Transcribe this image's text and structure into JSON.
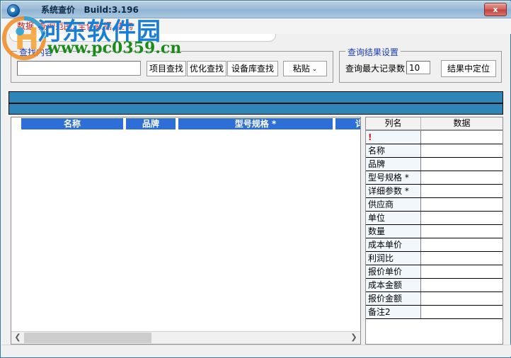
{
  "window": {
    "title": "系统查价   Build:3.196",
    "icon": "app-globe-icon",
    "close_label": "x",
    "accent_blue": "#2e86b8",
    "header_blue": "#2d6fd6",
    "menu_red": "#d81818",
    "legend_blue": "#1a3bb5"
  },
  "menubar": {
    "items": [
      {
        "label": "数据"
      },
      {
        "label": "查询范围: 全体数据"
      },
      {
        "label": "查询"
      }
    ]
  },
  "watermark": {
    "text_cn": "河东软件园",
    "text_url": "www.pc0359.cn",
    "color_cn": "#1a7fd4",
    "color_url": "#1b8a1b"
  },
  "find_group": {
    "legend": "查找内容",
    "input_value": "",
    "input_placeholder": "",
    "buttons": [
      {
        "label": "项目查找"
      },
      {
        "label": "优化查找"
      },
      {
        "label": "设备库查找"
      },
      {
        "label": "粘贴",
        "caret": "⌄"
      }
    ]
  },
  "result_group": {
    "legend": "查询结果设置",
    "max_records_label": "查询最大记录数",
    "max_records_value": "10",
    "locate_button": "结果中定位"
  },
  "grid": {
    "columns": [
      {
        "label": "名称"
      },
      {
        "label": "品牌"
      },
      {
        "label": "型号规格 *"
      },
      {
        "label": "详"
      }
    ],
    "rows": [],
    "scrollbar": {
      "left_arrow": "❮",
      "right_arrow": "❯"
    }
  },
  "detail_panel": {
    "headers": {
      "name": "列名",
      "value": "数据"
    },
    "rows": [
      {
        "name": "!",
        "value": ""
      },
      {
        "name": "名称",
        "value": ""
      },
      {
        "name": "品牌",
        "value": ""
      },
      {
        "name": "型号规格 *",
        "value": ""
      },
      {
        "name": "详细参数 *",
        "value": ""
      },
      {
        "name": "供应商",
        "value": ""
      },
      {
        "name": "单位",
        "value": ""
      },
      {
        "name": "数量",
        "value": ""
      },
      {
        "name": "成本单价",
        "value": ""
      },
      {
        "name": "利润比",
        "value": ""
      },
      {
        "name": "报价单价",
        "value": ""
      },
      {
        "name": "成本金额",
        "value": ""
      },
      {
        "name": "报价金额",
        "value": ""
      },
      {
        "name": "备注2",
        "value": ""
      }
    ]
  }
}
